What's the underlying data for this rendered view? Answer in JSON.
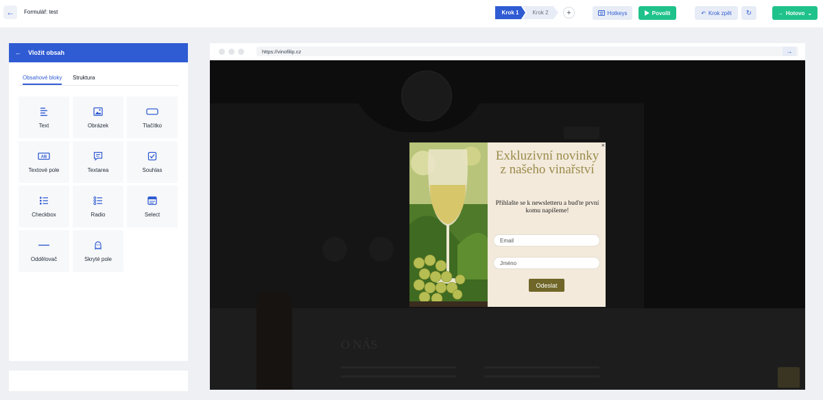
{
  "topbar": {
    "form_title": "Formulář: test",
    "steps": [
      "Krok 1",
      "Krok 2"
    ],
    "add_step": "+",
    "hotkeys": "Hotkeys",
    "enable": "Povolit",
    "undo": "Krok zpět",
    "done": "Hotovo"
  },
  "panel": {
    "title": "Vložit obsah",
    "tabs": [
      "Obsahové bloky",
      "Struktura"
    ],
    "blocks": [
      {
        "label": "Text",
        "icon": "text-icon"
      },
      {
        "label": "Obrázek",
        "icon": "image-icon"
      },
      {
        "label": "Tlačítko",
        "icon": "button-icon"
      },
      {
        "label": "Textové pole",
        "icon": "text-field-icon"
      },
      {
        "label": "Textarea",
        "icon": "textarea-icon"
      },
      {
        "label": "Souhlas",
        "icon": "checkbox-check-icon"
      },
      {
        "label": "Checkbox",
        "icon": "checklist-icon"
      },
      {
        "label": "Radio",
        "icon": "radio-list-icon"
      },
      {
        "label": "Select",
        "icon": "select-icon"
      },
      {
        "label": "Oddělovač",
        "icon": "divider-icon"
      },
      {
        "label": "Skryté pole",
        "icon": "ghost-icon"
      }
    ]
  },
  "browser": {
    "url": "https://vinofilip.cz"
  },
  "site": {
    "heading": "O NÁS"
  },
  "popup": {
    "title": "Exkluzivní novinky z našeho vinařství",
    "subtitle": "Přihlašte se k newsletteru a buďte první komu napíšeme!",
    "email_placeholder": "Email",
    "name_placeholder": "Jméno",
    "submit": "Odeslat",
    "close": "×"
  },
  "colors": {
    "accent": "#2f5bd3",
    "success": "#1fc28a",
    "popup_title": "#9a8b4a",
    "popup_button": "#6f6628"
  }
}
